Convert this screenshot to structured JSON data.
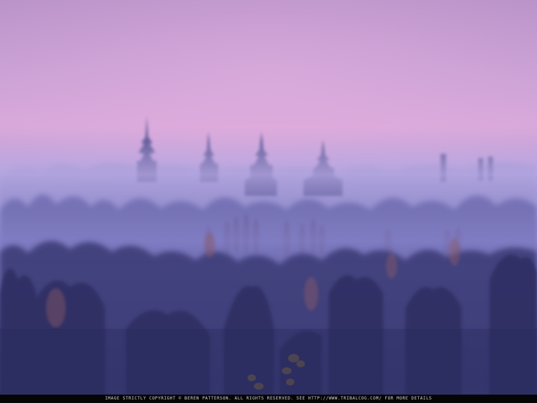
{
  "photo": {
    "subject": "Misty purple dawn over a forest with pagoda-style spires rising above the treetops",
    "palette": {
      "sky_top": "#c49ad0",
      "sky_mid": "#d9a7d9",
      "haze": "#a49ad8",
      "forest_dark": "#2c2e63",
      "forest_mid": "#4b4a8c",
      "spire": "#5a5a98",
      "autumn_leaf": "#8a5a52"
    }
  },
  "caption": {
    "text": "IMAGE STRICTLY COPYRIGHT © BEREN PATTERSON. ALL RIGHTS RESERVED. SEE HTTP://WWW.TRIBALCOG.COM/ FOR MORE DETAILS"
  }
}
